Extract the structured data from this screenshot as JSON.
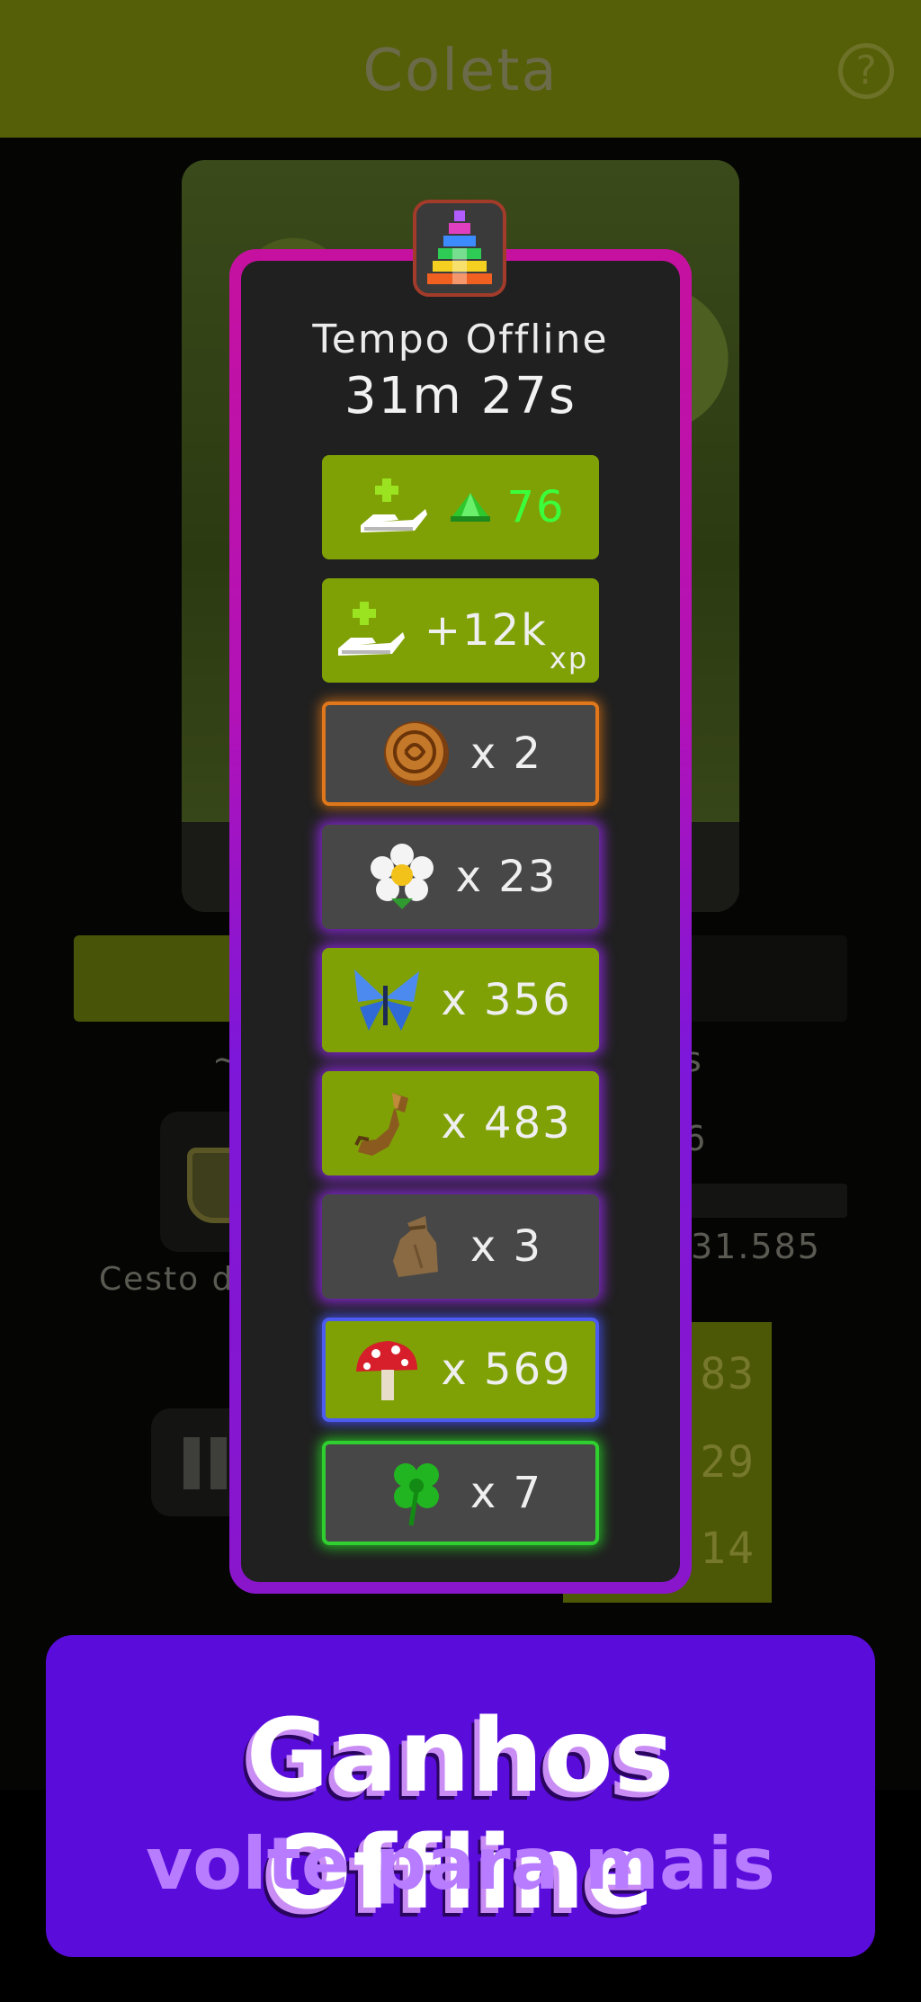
{
  "header": {
    "title": "Coleta",
    "help_icon": "?"
  },
  "background": {
    "status_left": "~",
    "status_right": "s",
    "value_6": "6",
    "basket_label": "Cesto d",
    "total": "31.585",
    "numbers": [
      "83",
      "29",
      "14"
    ]
  },
  "modal": {
    "title": "Tempo Offline",
    "time": "31m 27s",
    "rewards": [
      {
        "icon": "hand-gem-icon",
        "gem_icon": "green-gem-icon",
        "value": "76"
      },
      {
        "icon": "hand-plus-icon",
        "value": "+12k",
        "suffix": "xp"
      },
      {
        "icon": "coin-icon",
        "value": "x 2"
      },
      {
        "icon": "daisy-icon",
        "value": "x 23"
      },
      {
        "icon": "butterfly-icon",
        "value": "x 356"
      },
      {
        "icon": "root-icon",
        "value": "x 483"
      },
      {
        "icon": "sack-icon",
        "value": "x 3"
      },
      {
        "icon": "mushroom-icon",
        "value": "x 569"
      },
      {
        "icon": "clover-icon",
        "value": "x 7"
      }
    ]
  },
  "promo": {
    "title": "Ganhos Offline",
    "subtitle": "volte para mais"
  },
  "colors": {
    "accent_green": "#7fa106",
    "modal_border": "#b112b8",
    "promo_bg": "#5a0cdb",
    "gem_text": "#3cff3c"
  }
}
